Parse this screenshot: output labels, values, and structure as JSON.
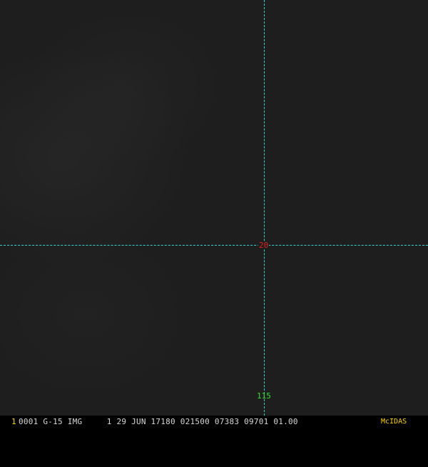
{
  "image": {
    "grid": {
      "color": "#2fd6d6",
      "latitude_label": "20",
      "latitude_label_color": "#e02020",
      "longitude_label": "115",
      "longitude_label_color": "#30e030"
    }
  },
  "status_bar": {
    "frame_number": "1",
    "frame_number_color": "#ffd400",
    "text": "0001 G-15 IMG     1 29 JUN 17180 021500 07383 09701 01.00",
    "brand": "McIDAS",
    "brand_color": "#ffd400"
  }
}
